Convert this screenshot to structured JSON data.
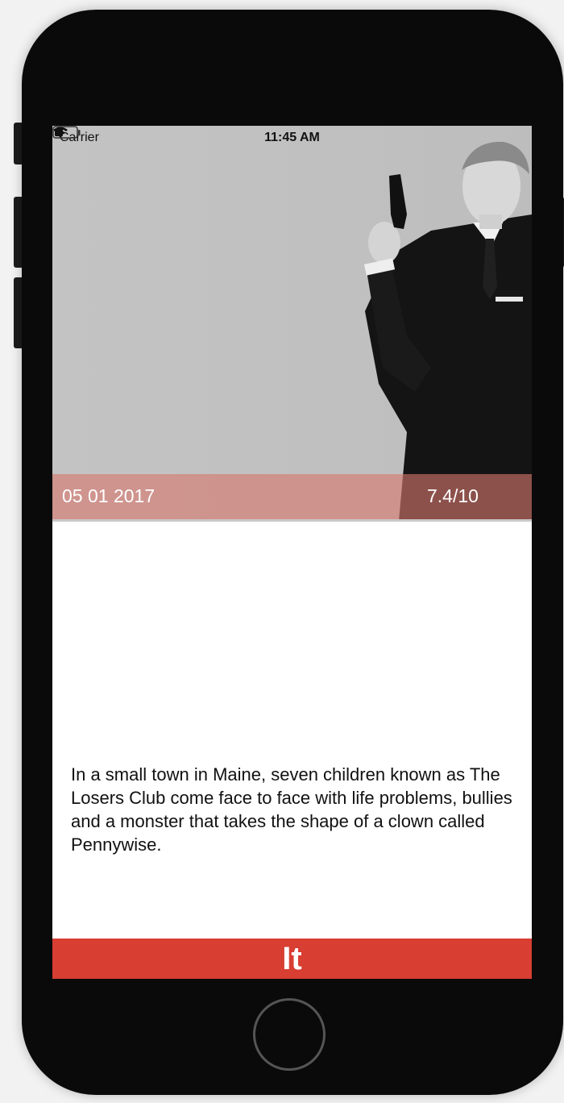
{
  "status_bar": {
    "carrier": "Carrier",
    "time": "11:45 AM",
    "wifi_icon": "wifi-icon",
    "battery_icon": "battery-icon"
  },
  "movie": {
    "release_date": "05 01 2017",
    "rating": "7.4/10",
    "overview": "In a small town in Maine, seven children known as The Losers Club come face to face with life problems, bullies and a monster that takes the shape of a clown called Pennywise.",
    "title": "It"
  },
  "colors": {
    "info_band": "#d6786e",
    "title_bar": "#d83e32",
    "poster_bg": "#c0c0c0"
  }
}
